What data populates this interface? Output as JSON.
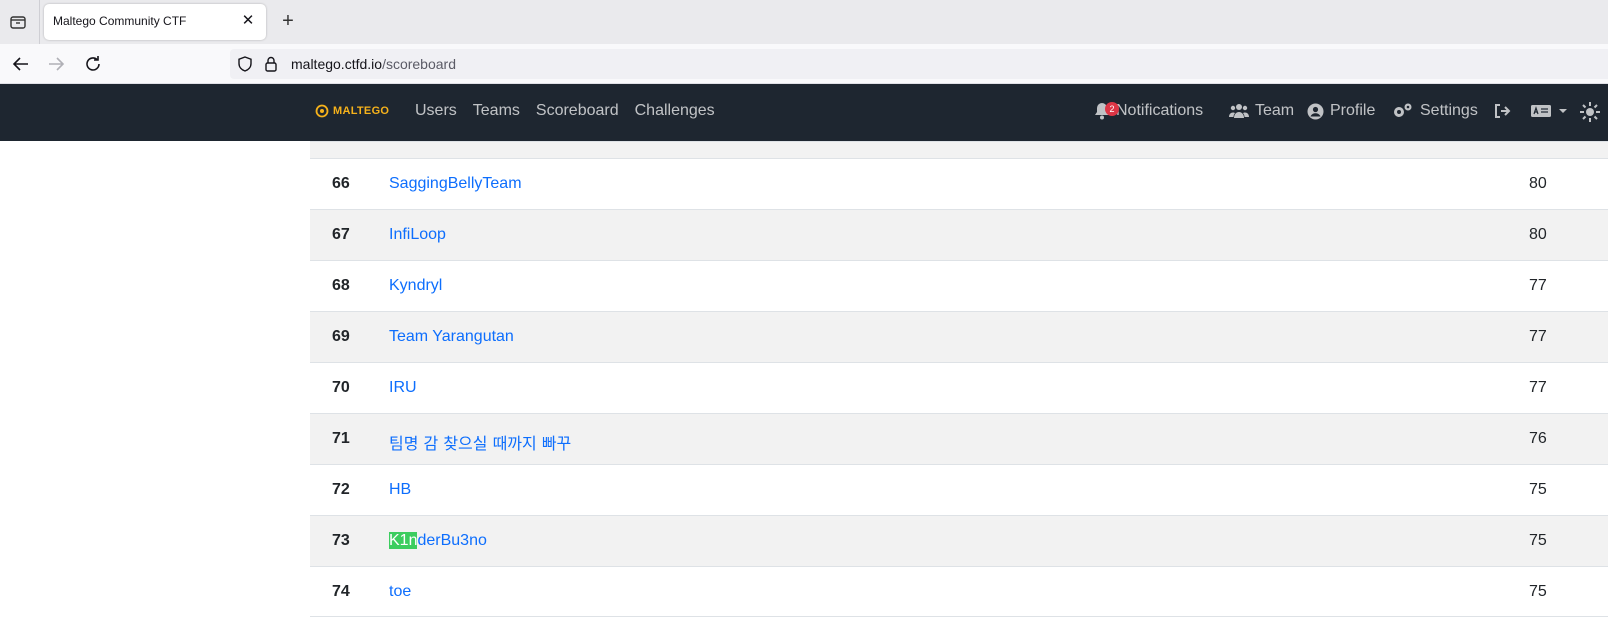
{
  "browser": {
    "tab_title": "Maltego Community CTF",
    "url_host": "maltego.ctfd.io",
    "url_path": "/scoreboard",
    "close_glyph": "✕",
    "new_tab_glyph": "+"
  },
  "site_nav": {
    "brand": "MALTEGO",
    "links": [
      "Users",
      "Teams",
      "Scoreboard",
      "Challenges"
    ],
    "notifications_label": "Notifications",
    "notifications_count": "2",
    "team_label": "Team",
    "profile_label": "Profile",
    "settings_label": "Settings"
  },
  "scoreboard": {
    "rows": [
      {
        "place": "66",
        "team": "SaggingBellyTeam",
        "score": "80"
      },
      {
        "place": "67",
        "team": "InfiLoop",
        "score": "80"
      },
      {
        "place": "68",
        "team": "Kyndryl",
        "score": "77"
      },
      {
        "place": "69",
        "team": "Team Yarangutan",
        "score": "77"
      },
      {
        "place": "70",
        "team": "IRU",
        "score": "77"
      },
      {
        "place": "71",
        "team": "팀명 감 찾으실 때까지 빠꾸",
        "score": "76"
      },
      {
        "place": "72",
        "team": "HB",
        "score": "75"
      },
      {
        "place": "73",
        "team_highlight": "K1n",
        "team_rest": "derBu3no",
        "score": "75"
      },
      {
        "place": "74",
        "team": "toe",
        "score": "75"
      }
    ]
  },
  "colors": {
    "nav_bg": "#1e2630",
    "link": "#0d6efd",
    "highlight": "#3ccd5f",
    "brand": "#f6b21b"
  }
}
